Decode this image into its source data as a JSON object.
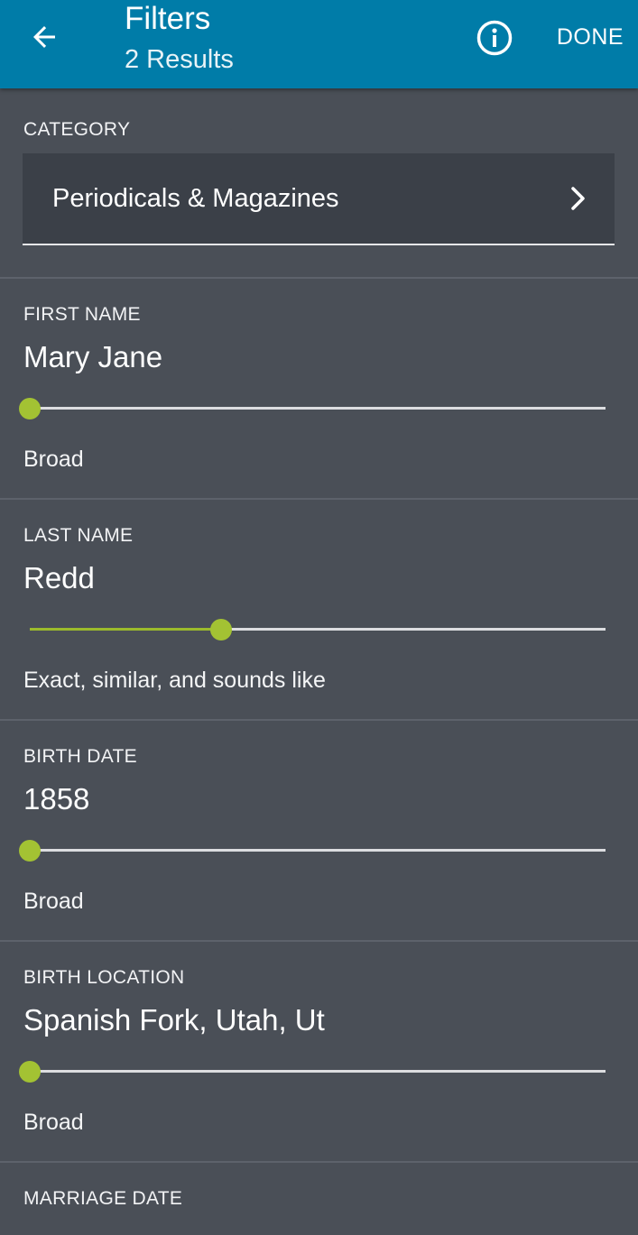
{
  "header": {
    "title": "Filters",
    "subtitle": "2 Results",
    "done_label": "DONE",
    "back_icon": "arrow-left-icon",
    "info_icon": "info-circle-icon",
    "background_color": "#007ca8"
  },
  "category": {
    "label": "CATEGORY",
    "value": "Periodicals & Magazines",
    "chevron_icon": "chevron-right-icon"
  },
  "fields": {
    "first_name": {
      "label": "FIRST NAME",
      "value": "Mary Jane",
      "slider_level": 0.0,
      "match_text": "Broad"
    },
    "last_name": {
      "label": "LAST NAME",
      "value": "Redd",
      "slider_level": 0.333,
      "match_text": "Exact, similar, and sounds like"
    },
    "birth_date": {
      "label": "BIRTH DATE",
      "value": "1858",
      "slider_level": 0.0,
      "match_text": "Broad"
    },
    "birth_location": {
      "label": "BIRTH LOCATION",
      "value": "Spanish Fork, Utah, Ut",
      "slider_level": 0.0,
      "match_text": "Broad"
    },
    "marriage_date": {
      "label": "MARRIAGE DATE"
    }
  },
  "colors": {
    "page_background": "#4a4f57",
    "slider_accent": "#a3c233",
    "slider_track": "#dcdde0"
  }
}
